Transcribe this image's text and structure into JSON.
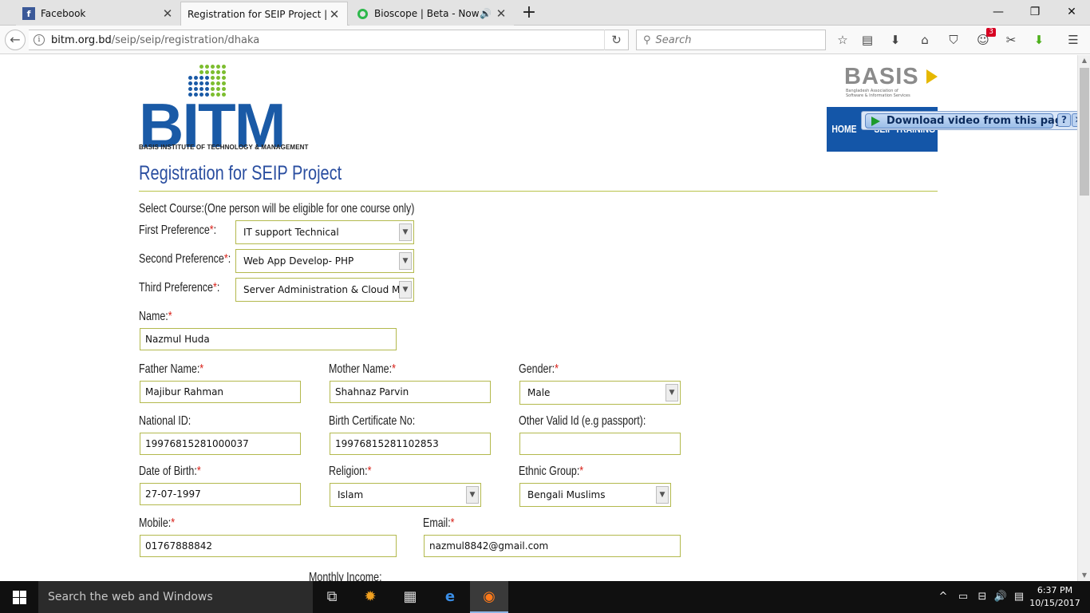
{
  "browser": {
    "tabs": [
      {
        "title": "Facebook",
        "icon": "facebook-icon",
        "active": false
      },
      {
        "title": "Registration for SEIP Project | BIT",
        "icon": "page-icon",
        "active": true
      },
      {
        "title": "Bioscope | Beta - Now Pl",
        "icon": "bioscope-icon",
        "active": false
      }
    ],
    "url_host": "bitm.org.bd",
    "url_path": "/seip/seip/registration/dhaka",
    "search_placeholder": "Search",
    "notification_count": "3"
  },
  "header": {
    "logo_text": "BITM",
    "logo_subtitle": "BASIS INSTITUTE OF TECHNOLOGY & MANAGEMENT",
    "partner_logo": "BASIS",
    "partner_subtitle_1": "Bangladesh Association of",
    "partner_subtitle_2": "Software & Information Services",
    "nav": [
      "HOME",
      "SEIP TRAINING"
    ],
    "download_bar_label": "Download video from this page"
  },
  "form": {
    "title": "Registration for SEIP Project",
    "course_intro": "Select Course:(One person will be eligible for one course only)",
    "first_pref_label": "First Preference",
    "first_pref_value": "IT support Technical",
    "second_pref_label": "Second Preference",
    "second_pref_value": "Web App Develop- PHP",
    "third_pref_label": "Third Preference",
    "third_pref_value": "Server Administration & Cloud Ma",
    "name_label": "Name:",
    "name_value": "Nazmul Huda",
    "father_label": "Father Name:",
    "father_value": "Majibur Rahman",
    "mother_label": "Mother Name:",
    "mother_value": "Shahnaz Parvin",
    "gender_label": "Gender:",
    "gender_value": "Male",
    "nid_label": "National ID:",
    "nid_value": "19976815281000037",
    "birthcert_label": "Birth Certificate No:",
    "birthcert_value": "19976815281102853",
    "otherid_label": "Other Valid Id (e.g passport):",
    "otherid_value": "",
    "dob_label": "Date of Birth:",
    "dob_value": "27-07-1997",
    "religion_label": "Religion:",
    "religion_value": "Islam",
    "ethnic_label": "Ethnic Group:",
    "ethnic_value": "Bengali Muslims",
    "mobile_label": "Mobile:",
    "mobile_value": "01767888842",
    "email_label": "Email:",
    "email_value": "nazmul8842@gmail.com",
    "income_label": "Monthly Income:",
    "required_mark": "*"
  },
  "taskbar": {
    "search_placeholder": "Search the web and Windows",
    "time": "6:37 PM",
    "date": "10/15/2017"
  },
  "colors": {
    "brand_blue": "#1a5aa6",
    "title_blue": "#2a4ea0",
    "field_border": "#b3b94d",
    "required_red": "#d9241c"
  }
}
